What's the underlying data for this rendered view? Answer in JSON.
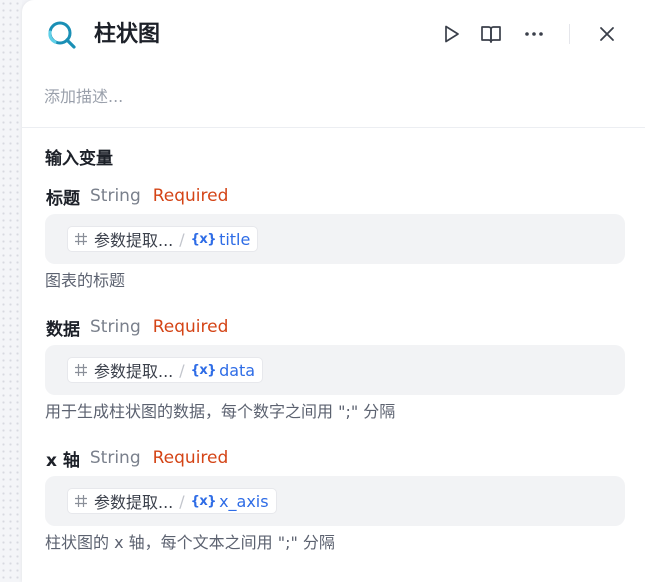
{
  "node": {
    "title": "柱状图",
    "description_placeholder": "添加描述...",
    "icon": "chart-magnifier-icon"
  },
  "header_actions": [
    {
      "name": "run",
      "icon": "play-icon"
    },
    {
      "name": "docs",
      "icon": "book-icon"
    },
    {
      "name": "more",
      "icon": "more-horizontal-icon"
    },
    {
      "name": "close",
      "icon": "close-icon"
    }
  ],
  "inputs": {
    "section_title": "输入变量",
    "fields": [
      {
        "name": "标题",
        "type": "String",
        "required": "Required",
        "source_label": "参数提取...",
        "variable_icon": "{x}",
        "variable": "title",
        "help": "图表的标题"
      },
      {
        "name": "数据",
        "type": "String",
        "required": "Required",
        "source_label": "参数提取...",
        "variable_icon": "{x}",
        "variable": "data",
        "help": "用于生成柱状图的数据，每个数字之间用 \";\" 分隔"
      },
      {
        "name": "x 轴",
        "type": "String",
        "required": "Required",
        "source_label": "参数提取...",
        "variable_icon": "{x}",
        "variable": "x_axis",
        "help": "柱状图的 x 轴，每个文本之间用 \";\" 分隔"
      }
    ]
  },
  "colors": {
    "accent": "#2e6ce6",
    "required": "#d44416",
    "icon_teal": "#1a8fb5"
  }
}
